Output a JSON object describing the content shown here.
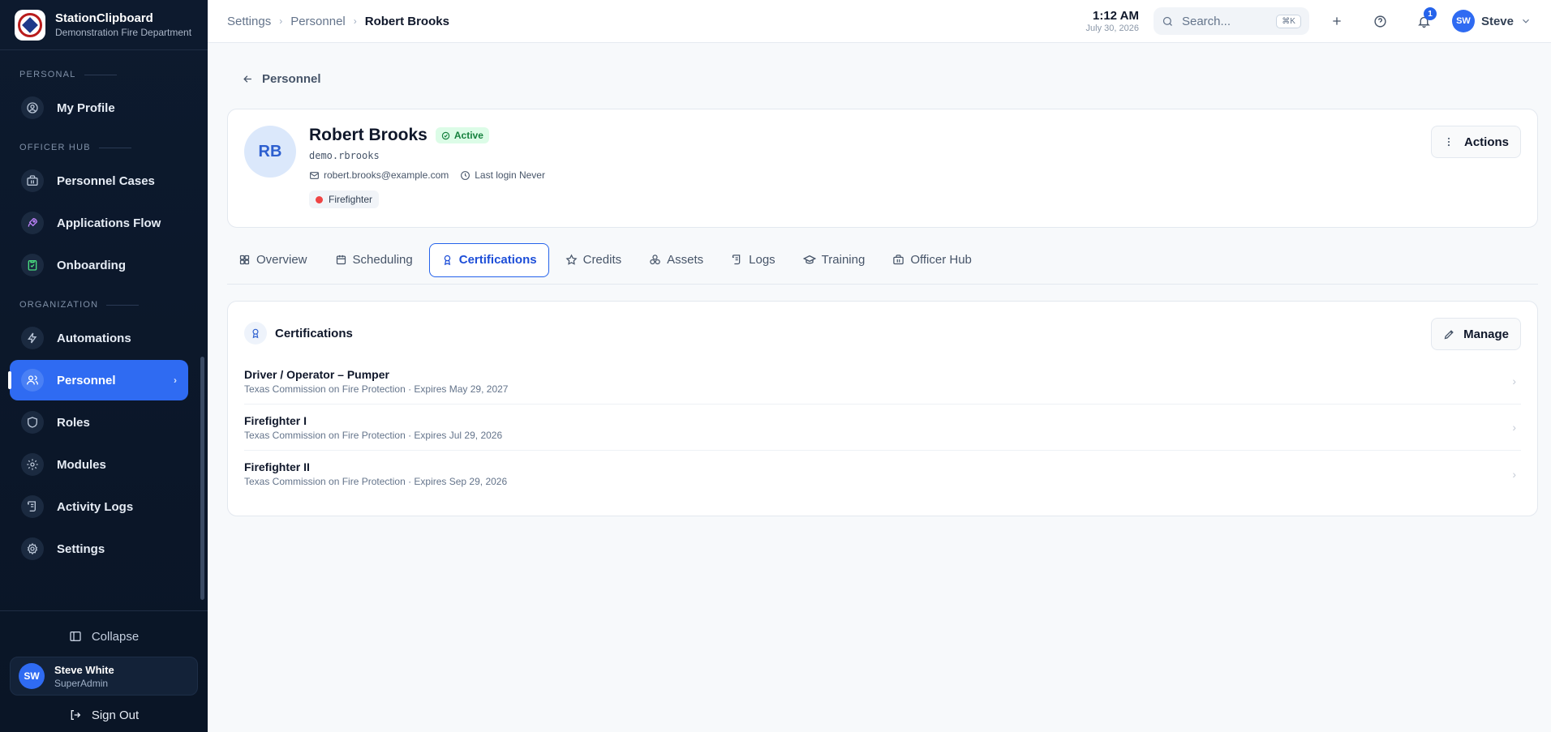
{
  "brand": {
    "name": "StationClipboard",
    "subtitle": "Demonstration Fire Department"
  },
  "sidebar": {
    "sections": [
      {
        "label": "PERSONAL",
        "items": [
          {
            "label": "My Profile",
            "icon": "user-circle-icon"
          }
        ]
      },
      {
        "label": "OFFICER HUB",
        "items": [
          {
            "label": "Personnel Cases",
            "icon": "briefcase-icon"
          },
          {
            "label": "Applications Flow",
            "icon": "rocket-icon"
          },
          {
            "label": "Onboarding",
            "icon": "clipboard-check-icon"
          }
        ]
      },
      {
        "label": "ORGANIZATION",
        "items": [
          {
            "label": "Automations",
            "icon": "bolt-icon"
          },
          {
            "label": "Personnel",
            "icon": "users-icon",
            "active": true
          },
          {
            "label": "Roles",
            "icon": "shield-icon"
          },
          {
            "label": "Modules",
            "icon": "gear-icon"
          },
          {
            "label": "Activity Logs",
            "icon": "scroll-icon"
          },
          {
            "label": "Settings",
            "icon": "settings-icon"
          }
        ]
      }
    ],
    "collapse_label": "Collapse",
    "user": {
      "initials": "SW",
      "name": "Steve White",
      "role": "SuperAdmin"
    },
    "signout_label": "Sign Out"
  },
  "topbar": {
    "breadcrumbs": [
      "Settings",
      "Personnel",
      "Robert Brooks"
    ],
    "time": "1:12 AM",
    "date": "July 30, 2026",
    "search_placeholder": "Search...",
    "search_shortcut": "⌘K",
    "notification_count": "1",
    "user_initials": "SW",
    "user_name": "Steve"
  },
  "main": {
    "back_label": "Personnel",
    "profile": {
      "initials": "RB",
      "name": "Robert Brooks",
      "status": "Active",
      "username": "demo.rbrooks",
      "email": "robert.brooks@example.com",
      "last_login": "Last login Never",
      "role": "Firefighter",
      "actions_label": "Actions"
    },
    "tabs": [
      {
        "label": "Overview",
        "icon": "grid-icon"
      },
      {
        "label": "Scheduling",
        "icon": "calendar-icon"
      },
      {
        "label": "Certifications",
        "icon": "award-icon",
        "active": true
      },
      {
        "label": "Credits",
        "icon": "star-icon"
      },
      {
        "label": "Assets",
        "icon": "boxes-icon"
      },
      {
        "label": "Logs",
        "icon": "log-icon"
      },
      {
        "label": "Training",
        "icon": "graduation-cap-icon"
      },
      {
        "label": "Officer Hub",
        "icon": "building-icon"
      }
    ],
    "certifications": {
      "title": "Certifications",
      "manage_label": "Manage",
      "items": [
        {
          "name": "Driver / Operator – Pumper",
          "detail": "Texas Commission on Fire Protection · Expires May 29, 2027"
        },
        {
          "name": "Firefighter I",
          "detail": "Texas Commission on Fire Protection · Expires Jul 29, 2026"
        },
        {
          "name": "Firefighter II",
          "detail": "Texas Commission on Fire Protection · Expires Sep 29, 2026"
        }
      ]
    }
  },
  "colors": {
    "accent": "#2f6bf2",
    "sidebar_bg": "#0d1a2e",
    "active_status": "#15803d",
    "role_dot": "#ef4444"
  }
}
